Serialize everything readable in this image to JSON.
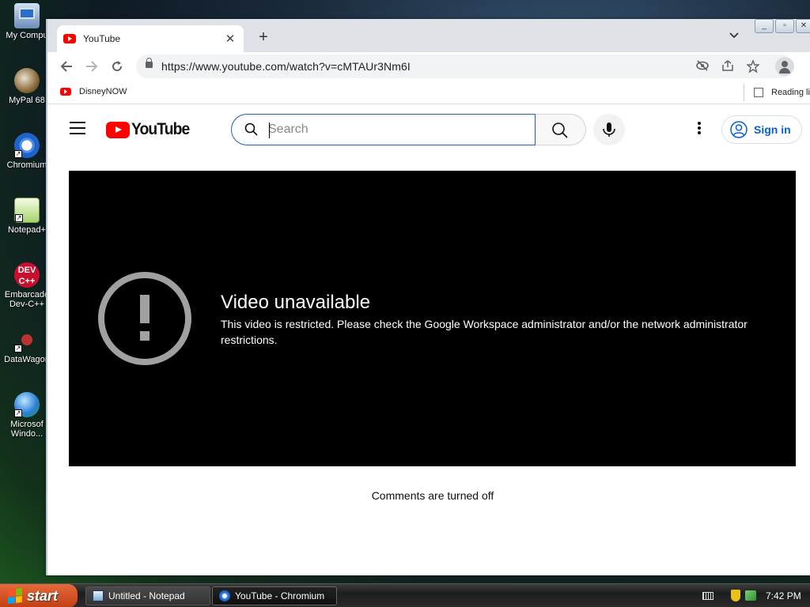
{
  "desktop": {
    "icons": [
      {
        "label": "My Compu"
      },
      {
        "label": "MyPal 68"
      },
      {
        "label": "Chromium"
      },
      {
        "label": "Notepad+"
      },
      {
        "label": "Embarcade\nDev-C++"
      },
      {
        "label": "DataWagon"
      },
      {
        "label": "Microsof\nWindo..."
      }
    ]
  },
  "browser": {
    "tab_title": "YouTube",
    "tab_close": "✕",
    "new_tab": "+",
    "url": "https://www.youtube.com/watch?v=cMTAUr3Nm6I",
    "bookmarks": [
      {
        "label": "DisneyNOW"
      }
    ],
    "reading_list": "Reading list"
  },
  "youtube": {
    "logo_text": "YouTube",
    "search_placeholder": "Search",
    "sign_in": "Sign in",
    "error_title": "Video unavailable",
    "error_message": "This video is restricted. Please check the Google Workspace administrator and/or the network administrator restrictions.",
    "comments_status": "Comments are turned off"
  },
  "taskbar": {
    "start_label": "start",
    "tasks": [
      {
        "label": "Untitled - Notepad"
      },
      {
        "label": "YouTube - Chromium"
      }
    ],
    "clock": "7:42 PM"
  },
  "colors": {
    "youtube_red": "#ff0000",
    "link_blue": "#065fd4",
    "search_border": "#1c62b9",
    "xp_start": "#d9531e"
  }
}
